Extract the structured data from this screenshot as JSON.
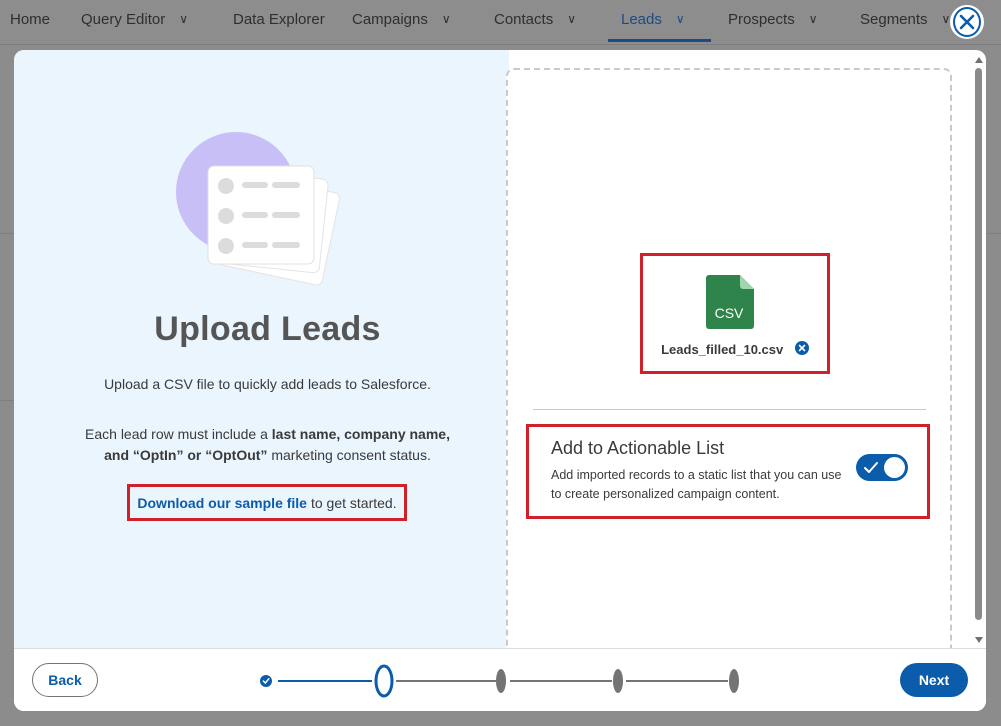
{
  "nav": {
    "items": [
      {
        "label": "Home",
        "chevron": false,
        "active": false
      },
      {
        "label": "Query Editor",
        "chevron": true,
        "active": false
      },
      {
        "label": "Data Explorer",
        "chevron": false,
        "active": false
      },
      {
        "label": "Campaigns",
        "chevron": true,
        "active": false
      },
      {
        "label": "Contacts",
        "chevron": true,
        "active": false
      },
      {
        "label": "Leads",
        "chevron": true,
        "active": true
      },
      {
        "label": "Prospects",
        "chevron": true,
        "active": false
      },
      {
        "label": "Segments",
        "chevron": true,
        "active": false
      }
    ]
  },
  "modal": {
    "title": "Upload Leads",
    "description": "Upload a CSV file to quickly add leads to Salesforce.",
    "requirements_prefix": "Each lead row must include a ",
    "requirements_bold1": "last name, company name,",
    "requirements_bold2": "and “OptIn” or “OptOut”",
    "requirements_suffix": " marketing consent status.",
    "sample_link": "Download our sample file",
    "sample_suffix": "to get started.",
    "file": {
      "icon": "csv-file-icon",
      "icon_label": "CSV",
      "name": "Leads_filled_10.csv",
      "remove_icon": "close-circle-icon"
    },
    "actionable_list": {
      "title": "Add to Actionable List",
      "description": "Add imported records to a static list that you can use to create personalized campaign content.",
      "enabled": true
    },
    "footer": {
      "back": "Back",
      "next": "Next",
      "steps_total": 5,
      "current_step": 2
    },
    "close_icon": "close-icon"
  },
  "colors": {
    "brand": "#0b5cab",
    "highlight": "#d0202a",
    "panel_bg": "#eaf5fe",
    "csv_green": "#2e844a"
  }
}
